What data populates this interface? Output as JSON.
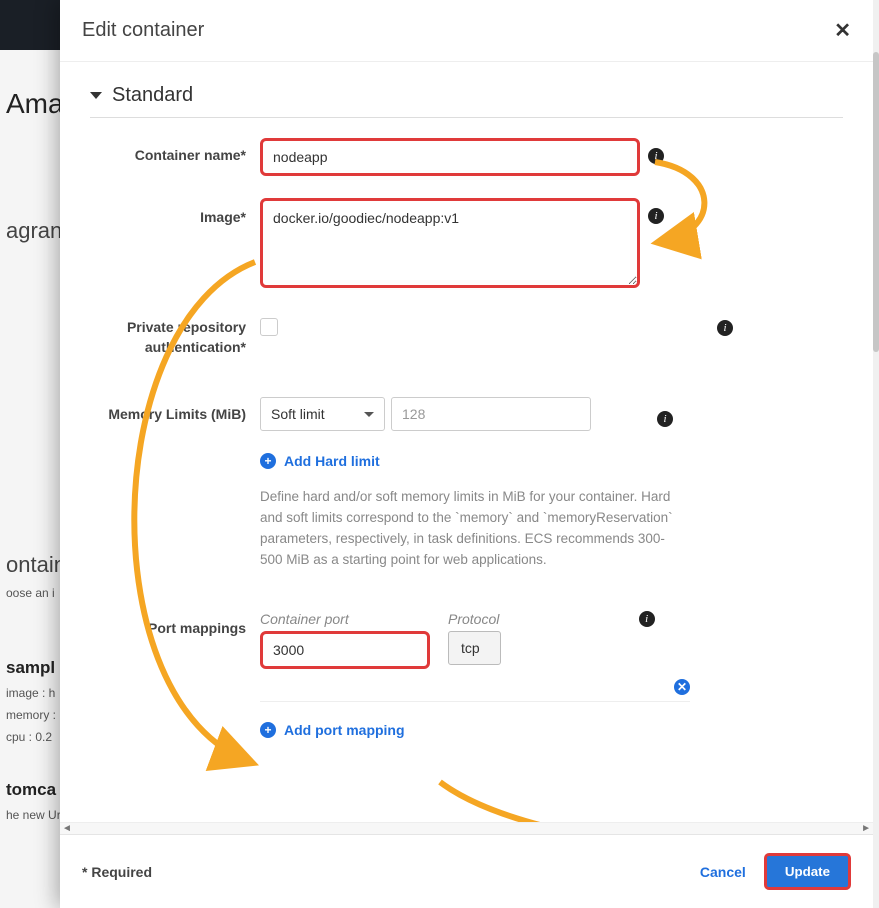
{
  "modal": {
    "title": "Edit container",
    "section_title": "Standard",
    "close_glyph": "✕",
    "required_note": "* Required",
    "cancel_label": "Cancel",
    "update_label": "Update"
  },
  "fields": {
    "container_name": {
      "label": "Container name*",
      "value": "nodeapp"
    },
    "image": {
      "label": "Image*",
      "value": "docker.io/goodiec/nodeapp:v1"
    },
    "private_repo": {
      "label": "Private repository authentication*",
      "checked": false
    },
    "memory": {
      "label": "Memory Limits (MiB)",
      "type_value": "Soft limit",
      "size_placeholder": "128",
      "add_hard_label": "Add Hard limit",
      "helper": "Define hard and/or soft memory limits in MiB for your container. Hard and soft limits correspond to the `memory` and `memoryReservation` parameters, respectively, in task definitions. ECS recommends 300-500 MiB as a starting point for web applications."
    },
    "port_mappings": {
      "label": "Port mappings",
      "col_container": "Container port",
      "col_protocol": "Protocol",
      "port_value": "3000",
      "protocol_value": "tcp",
      "add_label": "Add port mapping"
    }
  },
  "icons": {
    "info_glyph": "i",
    "plus_glyph": "+",
    "remove_glyph": "✕"
  },
  "background": {
    "header": "Ama",
    "item1": "agran",
    "item2": "ontain",
    "item2b": "oose an i",
    "item3": "sampl",
    "item3a": "image : h",
    "item3b": "memory :",
    "item3c": "cpu :  0.2",
    "item4": "tomca",
    "item4a": "he new Ur"
  }
}
